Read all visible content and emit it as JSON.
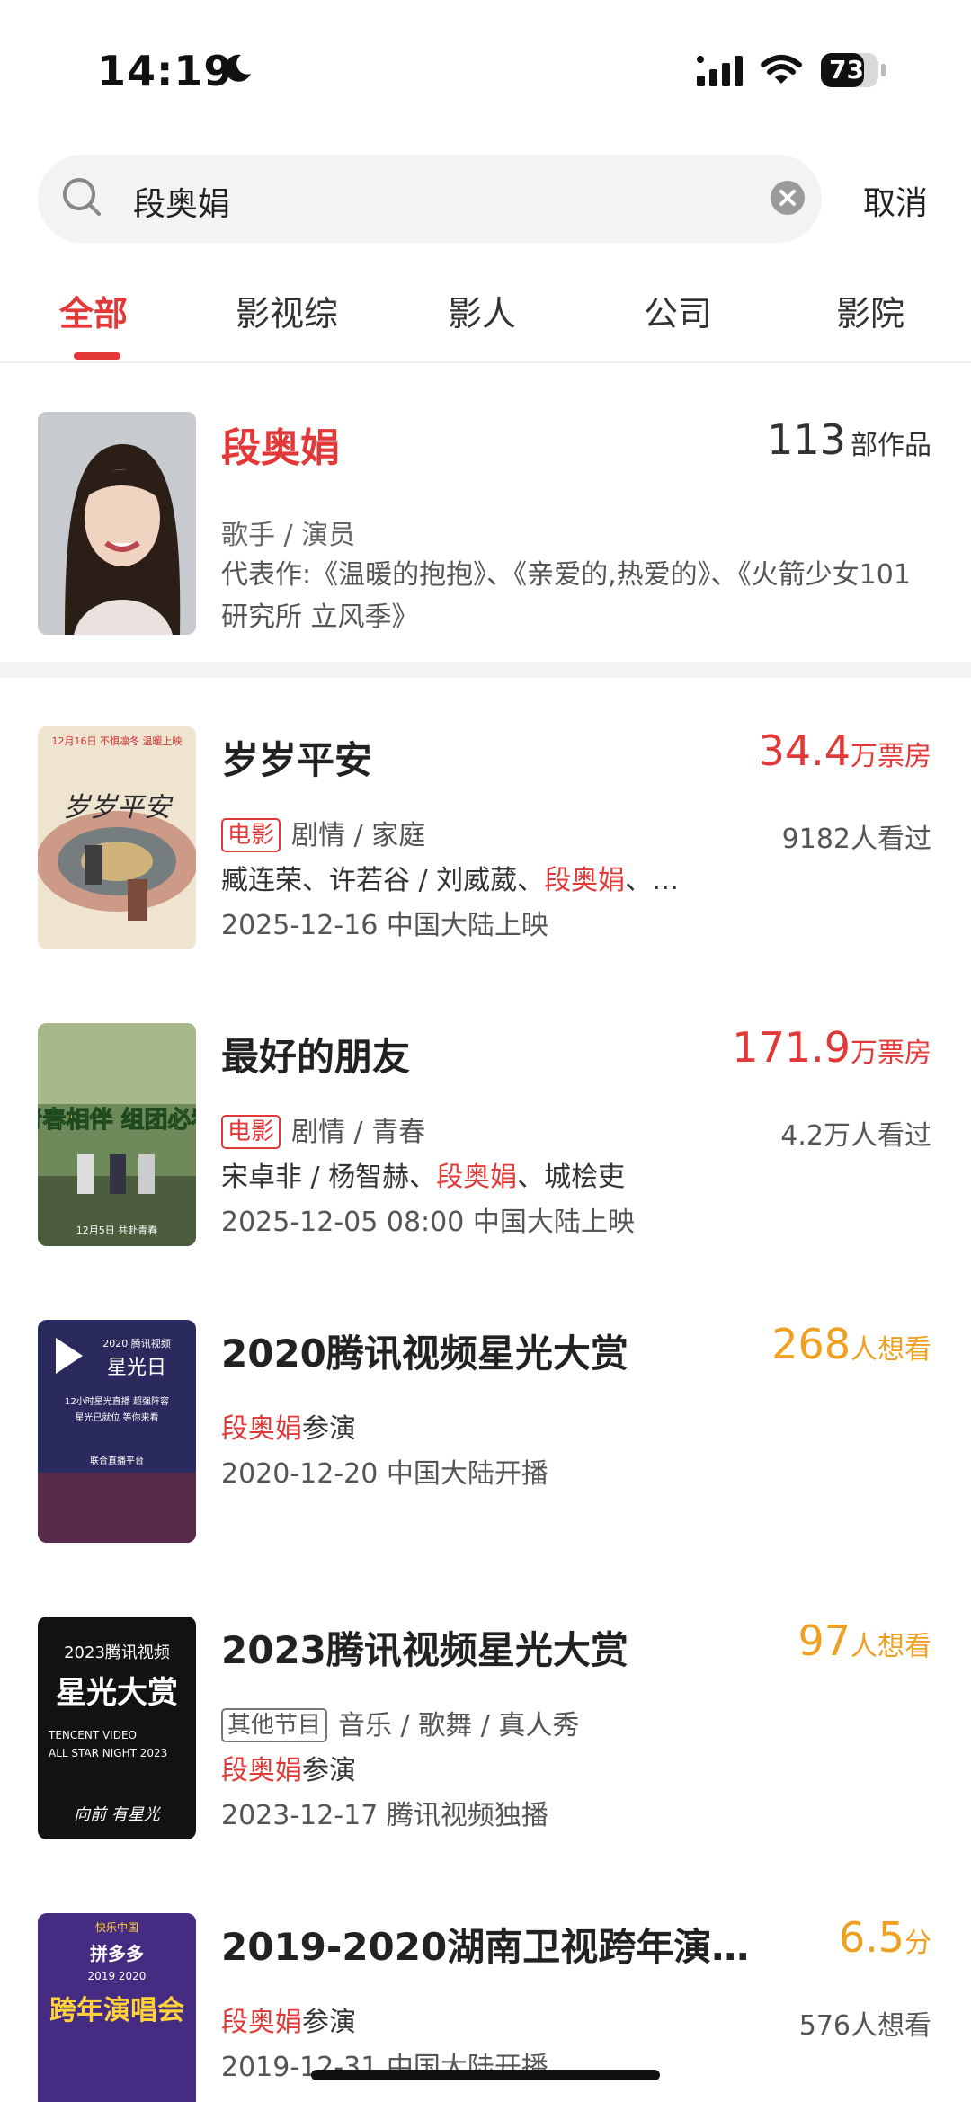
{
  "status_bar": {
    "time": "14:19",
    "battery": "73"
  },
  "search": {
    "query": "段奥娟",
    "cancel_label": "取消"
  },
  "tabs": [
    {
      "label": "全部",
      "active": true
    },
    {
      "label": "影视综",
      "active": false
    },
    {
      "label": "影人",
      "active": false
    },
    {
      "label": "公司",
      "active": false
    },
    {
      "label": "影院",
      "active": false
    }
  ],
  "person": {
    "name": "段奥娟",
    "works_count": "113",
    "works_label": "部作品",
    "role": "歌手 / 演员",
    "representative": "代表作:《温暖的抱抱》、《亲爱的,热爱的》、《火箭少女101研究所 立风季》"
  },
  "results": [
    {
      "title": "岁岁平安",
      "metric_value": "34.4",
      "metric_unit": "万票房",
      "tag": "电影",
      "genre": "剧情 / 家庭",
      "watch_count": "9182人看过",
      "cast_before": "臧连荣、许若谷 / 刘威葳、",
      "cast_highlight": "段奥娟",
      "cast_after": "、…",
      "release": "2025-12-16 中国大陆上映"
    },
    {
      "title": "最好的朋友",
      "metric_value": "171.9",
      "metric_unit": "万票房",
      "tag": "电影",
      "genre": "剧情 / 青春",
      "watch_count": "4.2万人看过",
      "cast_before": "宋卓非 / 杨智赫、",
      "cast_highlight": "段奥娟",
      "cast_after": "、城桧吏",
      "release": "2025-12-05 08:00 中国大陆上映"
    },
    {
      "title": "2020腾讯视频星光大赏",
      "metric_value": "268",
      "metric_unit": "人想看",
      "cast_highlight": "段奥娟",
      "cast_after": "参演",
      "release": "2020-12-20 中国大陆开播"
    },
    {
      "title": "2023腾讯视频星光大赏",
      "metric_value": "97",
      "metric_unit": "人想看",
      "tag": "其他节目",
      "genre": "音乐 / 歌舞 / 真人秀",
      "cast_highlight": "段奥娟",
      "cast_after": "参演",
      "release": "2023-12-17 腾讯视频独播"
    },
    {
      "title": "2019-2020湖南卫视跨年演…",
      "metric_value": "6.5",
      "metric_unit": "分",
      "cast_highlight": "段奥娟",
      "cast_after": "参演",
      "watch_count": "576人想看",
      "release": "2019-12-31 中国大陆开播"
    }
  ],
  "posters": [
    {
      "caption_top": "12月16日 不惧凛冬 温暖上映",
      "art_text": "岁岁平安"
    },
    {
      "art_text": "青春相伴 组团必看",
      "caption_bottom": "12月5日 共赴青春"
    },
    {
      "caption_top": "2020 腾讯视频",
      "art_text": "星光日",
      "line1": "12小时星光直播 超强阵容",
      "line2": "星光已就位 等你来看",
      "line3": "联合直播平台"
    },
    {
      "caption_top": "2023腾讯视频",
      "art_text": "星光大赏",
      "line1": "TENCENT VIDEO",
      "line2": "ALL STAR NIGHT 2023",
      "line3": "向前 有星光"
    },
    {
      "caption_top": "快乐中国",
      "line1": "拼多多",
      "line2": "2019 2020",
      "art_text": "跨年演唱会"
    }
  ]
}
